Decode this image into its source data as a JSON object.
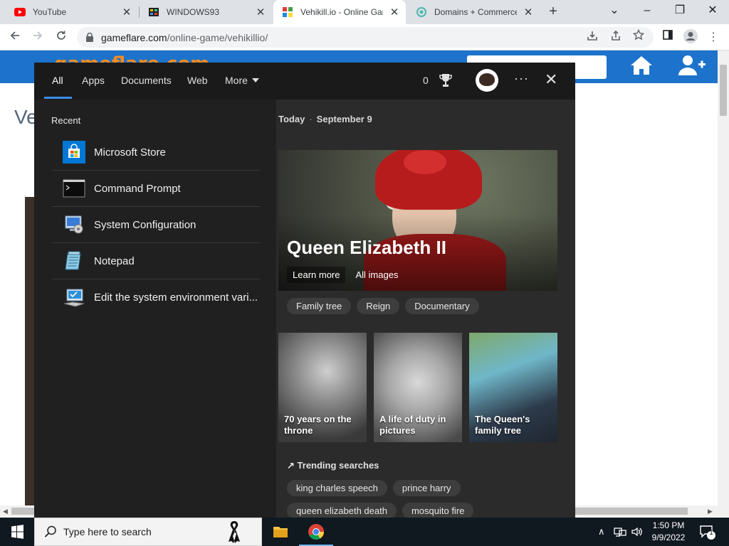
{
  "browser": {
    "tabs": [
      {
        "title": "YouTube",
        "active": false
      },
      {
        "title": "WINDOWS93",
        "active": false
      },
      {
        "title": "Vehikill.io - Online Gam",
        "active": true
      },
      {
        "title": "Domains + Commerce",
        "active": false
      }
    ],
    "close_glyph": "✕",
    "new_tab_glyph": "+",
    "url_host": "gameflare.com",
    "url_path": "/online-game/vehikillio/"
  },
  "webpage": {
    "logo_text": "gameflare.com",
    "title_fragment": "Ve"
  },
  "search_panel": {
    "tabs": [
      {
        "label": "All",
        "active": true
      },
      {
        "label": "Apps",
        "active": false
      },
      {
        "label": "Documents",
        "active": false
      },
      {
        "label": "Web",
        "active": false
      },
      {
        "label": "More",
        "active": false
      }
    ],
    "points": "0",
    "more_options_glyph": "···",
    "close_glyph": "✕",
    "recent_heading": "Recent",
    "recent_items": [
      {
        "label": "Microsoft Store",
        "icon": "store-icon"
      },
      {
        "label": "Command Prompt",
        "icon": "cmd-icon"
      },
      {
        "label": "System Configuration",
        "icon": "sysconfig-icon"
      },
      {
        "label": "Notepad",
        "icon": "notepad-icon"
      },
      {
        "label": "Edit the system environment vari...",
        "icon": "env-vars-icon"
      }
    ],
    "today_label": "Today",
    "date_separator": "·",
    "date": "September 9",
    "hero": {
      "title": "Queen Elizabeth II",
      "links": [
        "Learn more",
        "All images"
      ]
    },
    "topic_chips": [
      "Family tree",
      "Reign",
      "Documentary"
    ],
    "cards": [
      {
        "caption": "70 years on the throne"
      },
      {
        "caption": "A life of duty in pictures"
      },
      {
        "caption": "The Queen's family tree"
      }
    ],
    "trending_heading": "Trending searches",
    "trending": [
      "king charles speech",
      "prince harry",
      "queen elizabeth death",
      "mosquito fire"
    ]
  },
  "taskbar": {
    "search_placeholder": "Type here to search",
    "time": "1:50 PM",
    "date": "9/9/2022",
    "notification_count": "1"
  }
}
